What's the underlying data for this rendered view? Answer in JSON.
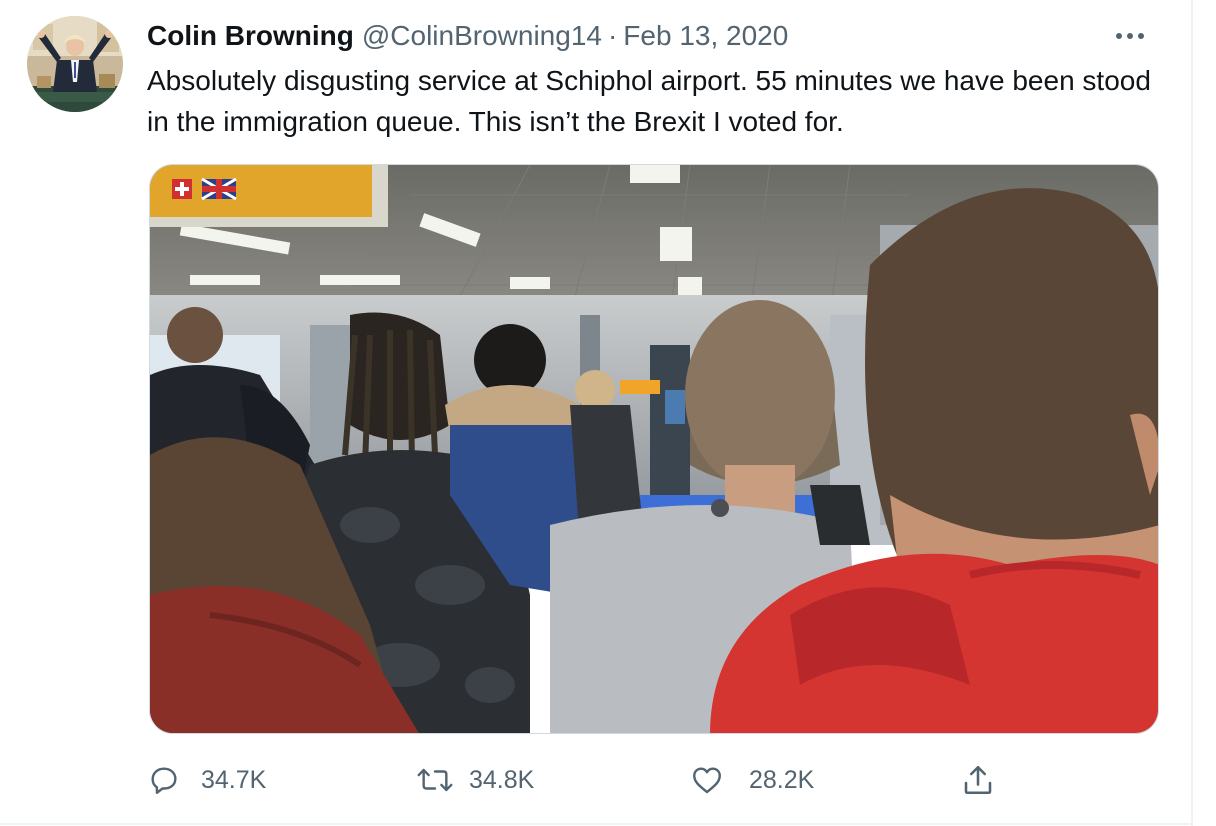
{
  "tweet": {
    "author": {
      "display_name": "Colin Browning",
      "handle": "@ColinBrowning14"
    },
    "separator": "·",
    "date": "Feb 13, 2020",
    "text": "Absolutely disgusting service at Schiphol airport. 55 minutes we have been stood in the immigration queue. This isn’t the Brexit I voted for.",
    "actions": {
      "reply_count": "34.7K",
      "retweet_count": "34.8K",
      "like_count": "28.2K"
    }
  },
  "icons": {
    "more": "more-horizontal-icon",
    "reply": "reply-icon",
    "retweet": "retweet-icon",
    "like": "heart-icon",
    "share": "share-icon"
  },
  "colors": {
    "text_primary": "#0f1419",
    "text_secondary": "#536471",
    "border": "#eff3f4"
  }
}
